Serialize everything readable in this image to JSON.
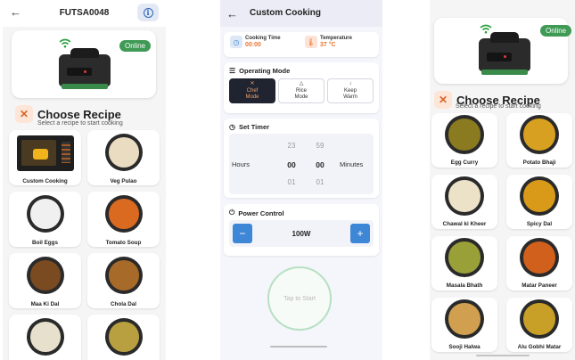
{
  "left_screen": {
    "device_code": "FUTSA0048",
    "status_badge": "Online",
    "recipe_section": {
      "title": "Choose Recipe",
      "subtitle": "Select a recipe to start cooking"
    },
    "recipes": [
      {
        "label": "Custom Cooking",
        "food_color": "#f2b21b"
      },
      {
        "label": "Veg Pulao",
        "food_color": "#e9dcc0"
      },
      {
        "label": "Boil Eggs",
        "food_color": "#f0f0f0"
      },
      {
        "label": "Tomato Soup",
        "food_color": "#d96a20"
      },
      {
        "label": "Maa Ki Dal",
        "food_color": "#7a4a20"
      },
      {
        "label": "Chola Dal",
        "food_color": "#a86a28"
      },
      {
        "label": "",
        "food_color": "#e6e0cc"
      },
      {
        "label": "",
        "food_color": "#b8a040"
      }
    ]
  },
  "middle_screen": {
    "title": "Custom Cooking",
    "cooking_time": {
      "label": "Cooking Time",
      "value": "00:00"
    },
    "temperature": {
      "label": "Temperature",
      "value": "37 °C"
    },
    "operating_mode": {
      "heading": "Operating Mode",
      "modes": [
        {
          "line1": "Chef",
          "line2": "Mode",
          "active": true
        },
        {
          "line1": "Rice",
          "line2": "Mode",
          "active": false
        },
        {
          "line1": "Keep",
          "line2": "Warm",
          "active": false
        }
      ]
    },
    "set_timer": {
      "heading": "Set Timer",
      "hours_label": "Hours",
      "minutes_label": "Minutes",
      "hours_prev": "23",
      "hours_current": "00",
      "hours_next": "01",
      "minutes_prev": "59",
      "minutes_current": "00",
      "minutes_next": "01"
    },
    "power_control": {
      "heading": "Power Control",
      "value": "100W",
      "minus": "−",
      "plus": "+"
    },
    "start_button": "Tap to Start"
  },
  "right_screen": {
    "status_badge": "Online",
    "recipe_section": {
      "title": "Choose Recipe",
      "subtitle": "Select a recipe to start cooking"
    },
    "recipes": [
      {
        "label": "Egg Curry",
        "food_color": "#8a7a20"
      },
      {
        "label": "Potato Bhaji",
        "food_color": "#d8a020"
      },
      {
        "label": "Chawal ki Kheer",
        "food_color": "#ece2c8"
      },
      {
        "label": "Spicy Dal",
        "food_color": "#d89a18"
      },
      {
        "label": "Masala Bhath",
        "food_color": "#9aa038"
      },
      {
        "label": "Matar Paneer",
        "food_color": "#d0601c"
      },
      {
        "label": "Sooji Halwa",
        "food_color": "#d0a050"
      },
      {
        "label": "Alu Gobhi Matar",
        "food_color": "#c8a028"
      }
    ]
  },
  "colors": {
    "online_green": "#3f9a55",
    "accent_orange": "#e8742f",
    "accent_blue": "#3e86d6"
  }
}
